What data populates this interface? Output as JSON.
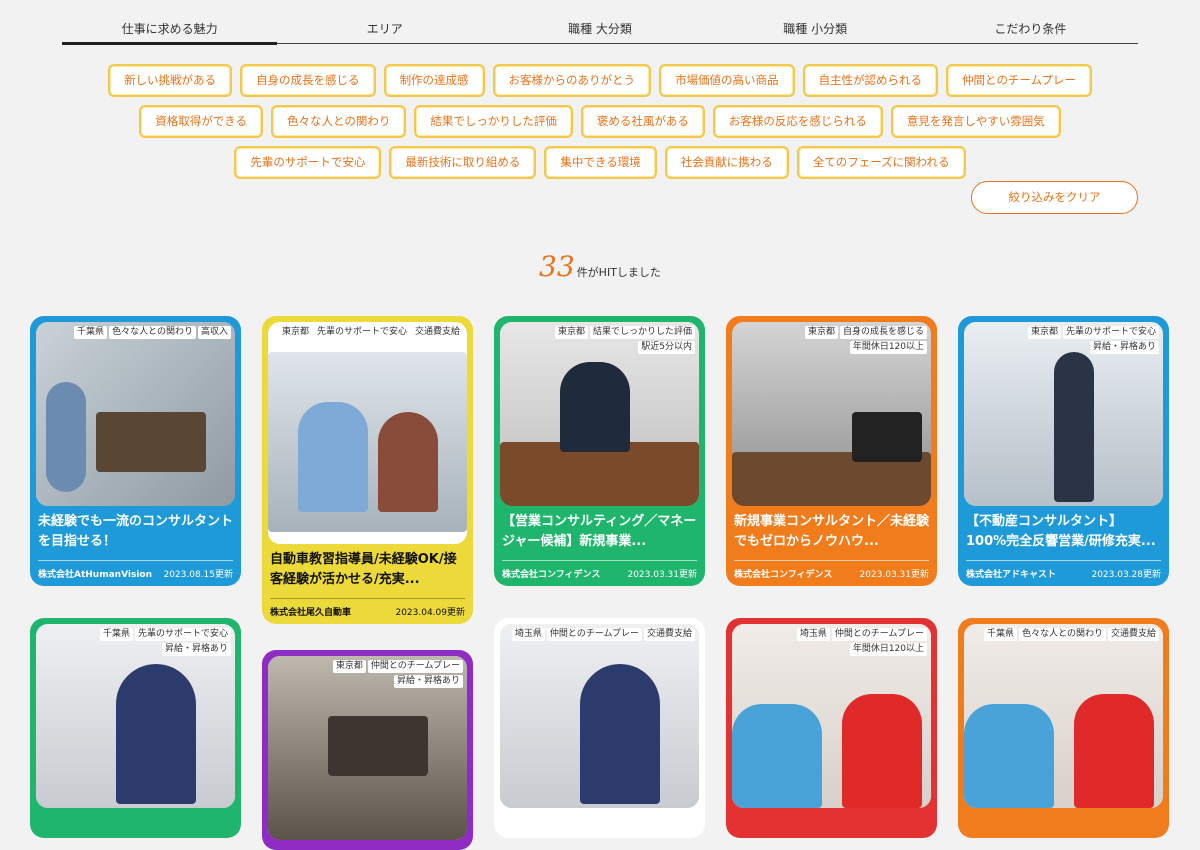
{
  "tabs": [
    "仕事に求める魅力",
    "エリア",
    "職種 大分類",
    "職種 小分類",
    "こだわり条件"
  ],
  "chips": {
    "row1": [
      "新しい挑戦がある",
      "自身の成長を感じる",
      "制作の達成感",
      "お客様からのありがとう",
      "市場価値の高い商品",
      "自主性が認められる",
      "仲間とのチームプレー"
    ],
    "row2": [
      "資格取得ができる",
      "色々な人との関わり",
      "結果でしっかりした評価",
      "褒める社風がある",
      "お客様の反応を感じられる",
      "意見を発言しやすい雰囲気"
    ],
    "row3": [
      "先輩のサポートで安心",
      "最新技術に取り組める",
      "集中できる環境",
      "社会貢献に携わる",
      "全てのフェーズに関われる"
    ]
  },
  "clear_label": "絞り込みをクリア",
  "hits": {
    "count": "33",
    "suffix": "件がHITしました"
  },
  "colors": {
    "accent": "#e8731a",
    "chip_border": "#f2c94c",
    "blue": "#1e9ad8",
    "yellow": "#ecd93a",
    "green": "#1fb56d",
    "orange": "#f07c1c",
    "purple": "#8e2cc4",
    "red": "#e23232"
  },
  "cards": [
    {
      "tags": [
        "千葉県",
        "色々な人との関わり",
        "高収入"
      ],
      "title": "未経験でも一流のコンサルタントを目指せる！",
      "company": "株式会社AtHumanVision",
      "date": "2023.08.15更新"
    },
    {
      "tags": [
        "東京都",
        "先輩のサポートで安心",
        "交通費支給"
      ],
      "title": "自動車教習指導員/未経験OK/接客経験が活かせる/充実...",
      "company": "株式会社尾久自動車",
      "date": "2023.04.09更新"
    },
    {
      "tags": [
        "東京都",
        "結果でしっかりした評価",
        "駅近5分以内"
      ],
      "title": "【営業コンサルティング／マネージャー候補】新規事業...",
      "company": "株式会社コンフィデンス",
      "date": "2023.03.31更新"
    },
    {
      "tags": [
        "東京都",
        "自身の成長を感じる",
        "年間休日120以上"
      ],
      "title": "新規事業コンサルタント／未経験でもゼロからノウハウ...",
      "company": "株式会社コンフィデンス",
      "date": "2023.03.31更新"
    },
    {
      "tags": [
        "東京都",
        "先輩のサポートで安心",
        "昇給・昇格あり"
      ],
      "title": "【不動産コンサルタント】100%完全反響営業/研修充実...",
      "company": "株式会社アドキャスト",
      "date": "2023.03.28更新"
    },
    {
      "tags": [
        "千葉県",
        "先輩のサポートで安心",
        "昇給・昇格あり"
      ]
    },
    {
      "tags": [
        "東京都",
        "仲間とのチームプレー",
        "昇給・昇格あり"
      ]
    },
    {
      "tags": [
        "埼玉県",
        "仲間とのチームプレー",
        "交通費支給"
      ]
    },
    {
      "tags": [
        "埼玉県",
        "仲間とのチームプレー",
        "年間休日120以上"
      ]
    },
    {
      "tags": [
        "千葉県",
        "色々な人との関わり",
        "交通費支給"
      ]
    }
  ]
}
